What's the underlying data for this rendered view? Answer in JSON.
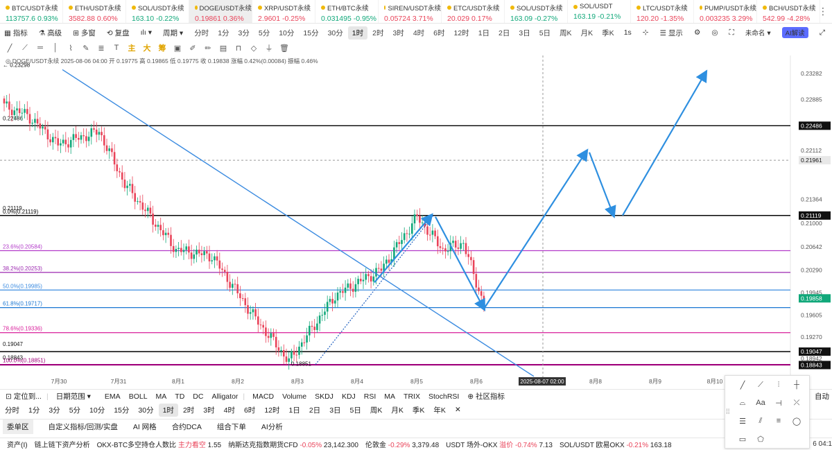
{
  "tickers": [
    {
      "name": "BTC/USDT永续",
      "price": "113757.6",
      "change": "0.93%",
      "dir": "up"
    },
    {
      "name": "ETH/USDT永续",
      "price": "3582.88",
      "change": "0.60%",
      "dir": "down"
    },
    {
      "name": "SOL/USDT永续",
      "price": "163.10",
      "change": "-0.22%",
      "dir": "up"
    },
    {
      "name": "DOGE/USDT永续",
      "price": "0.19861",
      "change": "0.36%",
      "dir": "down",
      "active": true
    },
    {
      "name": "XRP/USDT永续",
      "price": "2.9601",
      "change": "-0.25%",
      "dir": "down"
    },
    {
      "name": "ETH/BTC永续",
      "price": "0.031495",
      "change": "-0.95%",
      "dir": "up"
    },
    {
      "name": "SIREN/USDT永续",
      "price": "0.05724",
      "change": "3.71%",
      "dir": "down"
    },
    {
      "name": "ETC/USDT永续",
      "price": "20.029",
      "change": "0.17%",
      "dir": "down"
    },
    {
      "name": "SOL/USDT永续",
      "price": "163.09",
      "change": "-0.27%",
      "dir": "up"
    },
    {
      "name": "SOL/USDT",
      "price": "163.19",
      "change": "-0.21%",
      "dir": "up"
    },
    {
      "name": "LTC/USDT永续",
      "price": "120.20",
      "change": "-1.35%",
      "dir": "down"
    },
    {
      "name": "PUMP/USDT永续",
      "price": "0.003235",
      "change": "3.29%",
      "dir": "down"
    },
    {
      "name": "BCH/USDT永续",
      "price": "542.99",
      "change": "-4.28%",
      "dir": "down"
    }
  ],
  "toolbar": {
    "indicator": "指标",
    "advanced": "高级",
    "multi": "多窗",
    "replay": "复盘",
    "period": "周期",
    "timeframes": [
      "分时",
      "1分",
      "3分",
      "5分",
      "10分",
      "15分",
      "30分",
      "1时",
      "2时",
      "3时",
      "4时",
      "6时",
      "12时",
      "1日",
      "2日",
      "3日",
      "5日",
      "周K",
      "月K",
      "季K"
    ],
    "selected_tf": "1时",
    "seconds": "1s",
    "display": "显示",
    "unnamed": "未命名",
    "ai": "AI解读"
  },
  "draw_tools": {
    "colorful": [
      "主",
      "大",
      "筹"
    ]
  },
  "legend": "DOGE/USDT永续  2025-08-06 04:00  开 0.19775  高 0.19865  低 0.19775  收 0.19838  涨幅 0.42%(0.00084)  振幅 0.46%",
  "chart_data": {
    "type": "candlestick",
    "symbol": "DOGE/USDT永续",
    "interval": "1时",
    "ylim": [
      0.187,
      0.2345
    ],
    "x_ticks": [
      "7月30",
      "7月31",
      "8月1",
      "8月2",
      "8月3",
      "8月4",
      "8月5",
      "8月6",
      "8月7",
      "8月8",
      "8月9",
      "8月10"
    ],
    "y_ticks": [
      0.23282,
      0.22885,
      0.22486,
      0.22112,
      0.21961,
      0.21364,
      0.21119,
      0.21,
      0.20642,
      0.2029,
      0.19945,
      0.19858,
      0.19605,
      0.1927,
      0.19047,
      0.18942,
      0.18843
    ],
    "horizontal_lines": [
      {
        "price": 0.22486,
        "color": "#000000"
      },
      {
        "price": 0.21119,
        "color": "#000000"
      },
      {
        "price": 0.19047,
        "color": "#000000"
      },
      {
        "price": 0.18843,
        "color": "#a0007a"
      }
    ],
    "fib_levels": [
      {
        "label": "0.0%(0.21119)",
        "price": 0.21119,
        "color": "#000000"
      },
      {
        "label": "23.6%(0.20584)",
        "price": 0.20584,
        "color": "#b23ac9"
      },
      {
        "label": "38.2%(0.20253)",
        "price": 0.20253,
        "color": "#9c27b0"
      },
      {
        "label": "50.0%(0.19985)",
        "price": 0.19985,
        "color": "#3b8be0"
      },
      {
        "label": "61.8%(0.19717)",
        "price": 0.19717,
        "color": "#1976d2"
      },
      {
        "label": "78.6%(0.19336)",
        "price": 0.19336,
        "color": "#d81b9a"
      },
      {
        "label": "100.0%(0.18851)",
        "price": 0.18851,
        "color": "#a0007a"
      }
    ],
    "price_labels": [
      "0.23298",
      "0.22486",
      "0.21119",
      "0.19047",
      "0.18843",
      "0.18851"
    ],
    "current_price": 0.19858,
    "crosshair_price": 0.21961,
    "crosshair_time": "2025-08-07 02:00"
  },
  "bottom": {
    "position": "定位到...",
    "date_range": "日期范围",
    "main_indicators": [
      "EMA",
      "BOLL",
      "MA",
      "TD",
      "DC",
      "Alligator"
    ],
    "sub_indicators": [
      "MACD",
      "Volume",
      "SKDJ",
      "KDJ",
      "RSI",
      "MA",
      "TRIX",
      "StochRSI"
    ],
    "community": "社区指标",
    "auto": "自动",
    "timeframes": [
      "分时",
      "1分",
      "3分",
      "5分",
      "10分",
      "15分",
      "30分",
      "1时",
      "2时",
      "3时",
      "4时",
      "6时",
      "12时",
      "1日",
      "2日",
      "3日",
      "5日",
      "周K",
      "月K",
      "季K",
      "年K"
    ],
    "selected_tf": "1时",
    "tabs": [
      "委单区",
      "自定义指标/回测/实盘",
      "AI 网格",
      "合约DCA",
      "组合下单",
      "AI分析"
    ],
    "status": [
      {
        "label": "资产(Ⅰ)",
        "value": ""
      },
      {
        "label": "链上链下资产分析",
        "value": ""
      },
      {
        "label": "OKX-BTC多空持仓人数比",
        "value": "主力看空",
        "extra": "1.55"
      },
      {
        "label": "纳斯达克指数期货CFD",
        "value": "-0.05%",
        "extra": "23,142.300"
      },
      {
        "label": "伦敦金",
        "value": "-0.29%",
        "extra": "3,379.48"
      },
      {
        "label": "USDT 场外-OKX",
        "value": "溢价 -0.74%",
        "extra": "7.13"
      },
      {
        "label": "SOL/USDT 欧易OKX",
        "value": "-0.21%",
        "extra": "163.18"
      }
    ],
    "clock": "6 04:1"
  },
  "popup": {
    "items": [
      "trend-line",
      "ray",
      "parallel",
      "vertical",
      "pattern",
      "Aa",
      "arrow-h",
      "cross-lines",
      "fib-lines",
      "channel",
      "lines",
      "ellipse",
      "rect",
      "polygon"
    ],
    "text_label": "Aa"
  }
}
